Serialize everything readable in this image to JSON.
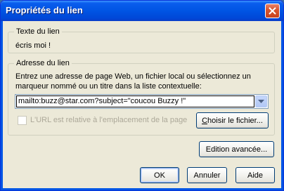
{
  "window": {
    "title": "Propriétés du lien"
  },
  "link_text_group": {
    "legend": "Texte du lien",
    "value": "écris moi !"
  },
  "link_address_group": {
    "legend": "Adresse du lien",
    "instructions_line1": "Entrez une adresse de page Web, un fichier local ou sélectionnez un",
    "instructions_line2": "marqueur nommé ou un titre dans la liste contextuelle:",
    "url_value": "mailto:buzz@star.com?subject=\"coucou Buzzy !\"",
    "relative_checkbox_label": "L'URL est relative à l'emplacement de la page",
    "relative_checked": false,
    "choose_file_label": "Choisir le fichier..."
  },
  "advanced_edit_label": "Edition avancée...",
  "buttons": {
    "ok": "OK",
    "cancel": "Annuler",
    "help": "Aide"
  },
  "colors": {
    "titlebar": "#0054e3",
    "dialog_bg": "#ece9d8",
    "disabled_text": "#aca899"
  }
}
